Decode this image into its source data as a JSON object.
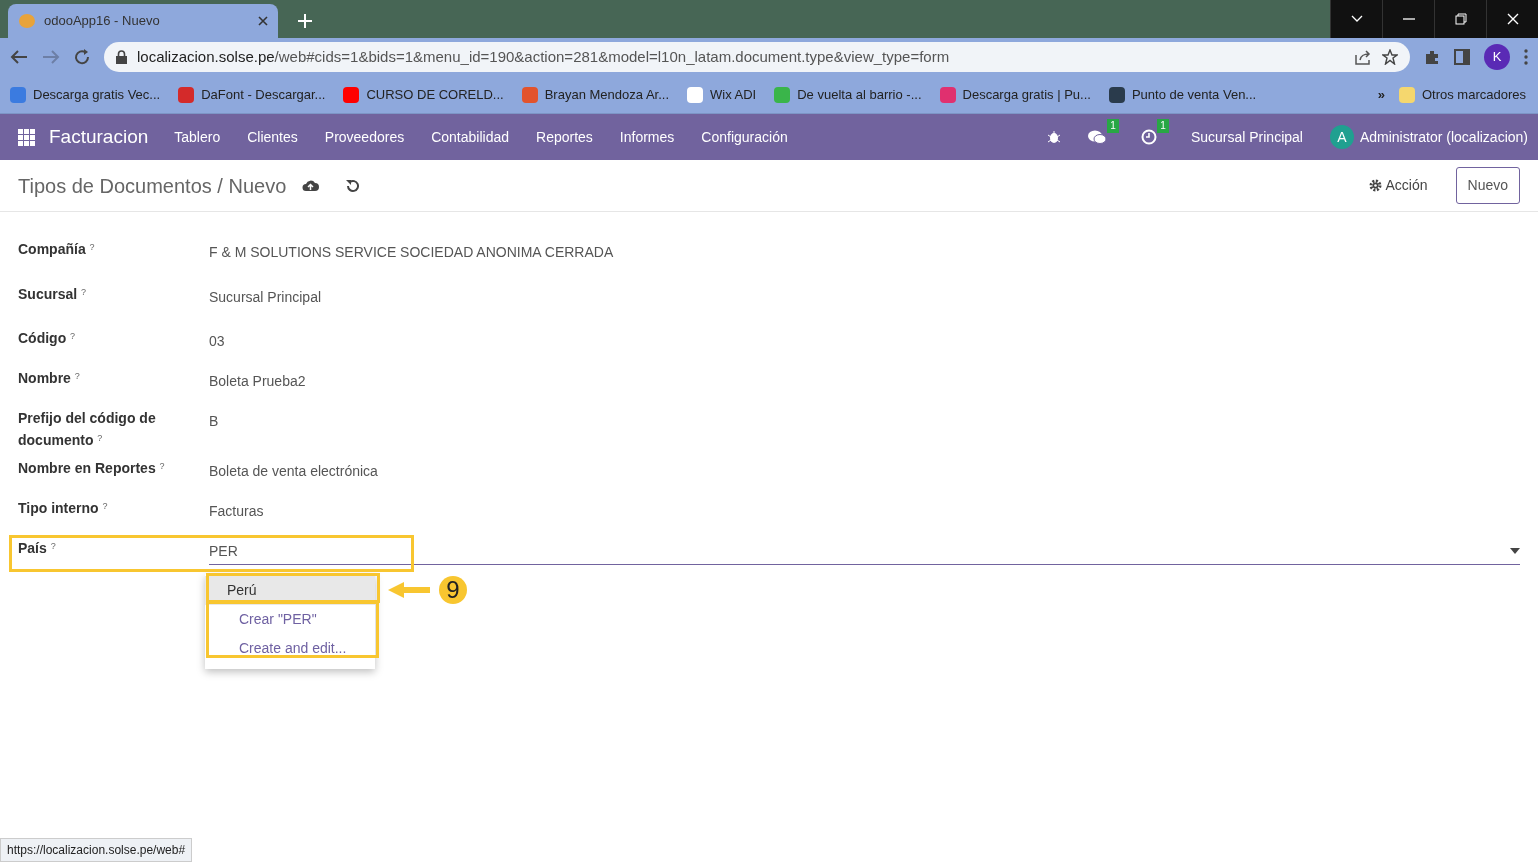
{
  "browser": {
    "tab_title": "odooApp16 - Nuevo",
    "url_host": "localizacion.solse.pe",
    "url_path": "/web#cids=1&bids=1&menu_id=190&action=281&model=l10n_latam.document.type&view_type=form",
    "profile_initial": "K",
    "bookmarks": [
      {
        "label": "Descarga gratis Vec...",
        "color": "#3b7be0"
      },
      {
        "label": "DaFont - Descargar...",
        "color": "#d42a2a"
      },
      {
        "label": "CURSO DE CORELD...",
        "color": "#ff0000"
      },
      {
        "label": "Brayan Mendoza Ar...",
        "color": "#e2532d"
      },
      {
        "label": "Wix ADI",
        "color": "#ffffff"
      },
      {
        "label": "De vuelta al barrio -...",
        "color": "#3ab54a"
      },
      {
        "label": "Descarga gratis | Pu...",
        "color": "#e0306f"
      },
      {
        "label": "Punto de venta Ven...",
        "color": "#2a3b4c"
      }
    ],
    "more": "»",
    "other_bookmarks": "Otros marcadores"
  },
  "navbar": {
    "app": "Facturacion",
    "menus": [
      "Tablero",
      "Clientes",
      "Proveedores",
      "Contabilidad",
      "Reportes",
      "Informes",
      "Configuración"
    ],
    "systray": [
      {
        "kind": "bug"
      },
      {
        "kind": "chat",
        "count": "1"
      },
      {
        "kind": "activity",
        "count": "1"
      }
    ],
    "company": "Sucursal Principal",
    "user_initial": "A",
    "user": "Administrator (localizacion)"
  },
  "control_panel": {
    "breadcrumb": "Tipos de Documentos / Nuevo",
    "action": "Acción",
    "new_button": "Nuevo"
  },
  "form": {
    "fields": [
      {
        "label": "Compañía",
        "help": "?",
        "value": "F & M SOLUTIONS SERVICE SOCIEDAD ANONIMA CERRADA",
        "kind": "text"
      },
      {
        "label": "Sucursal",
        "help": "?",
        "value": "Sucursal Principal",
        "kind": "text"
      },
      {
        "label": "Código",
        "help": "?",
        "value": "03",
        "kind": "text"
      },
      {
        "label": "Nombre",
        "help": "?",
        "value": "Boleta Prueba2",
        "kind": "text"
      },
      {
        "label": "Prefijo del código de documento",
        "help": "?",
        "value": "B",
        "kind": "text"
      },
      {
        "label": "Nombre en Reportes",
        "help": "?",
        "value": "Boleta de venta electrónica",
        "kind": "text"
      },
      {
        "label": "Tipo interno",
        "help": "?",
        "value": "Facturas",
        "kind": "text"
      },
      {
        "label": "País",
        "help": "?",
        "value": "PER",
        "kind": "select"
      }
    ]
  },
  "dropdown": {
    "items": [
      {
        "label": "Perú",
        "kind": "option",
        "selected": true
      },
      {
        "label": "Crear \"PER\"",
        "kind": "action",
        "selected": false
      },
      {
        "label": "Create and edit...",
        "kind": "action",
        "selected": false
      }
    ]
  },
  "annotation": {
    "number": "9"
  },
  "status_url": "https://localizacion.solse.pe/web#"
}
